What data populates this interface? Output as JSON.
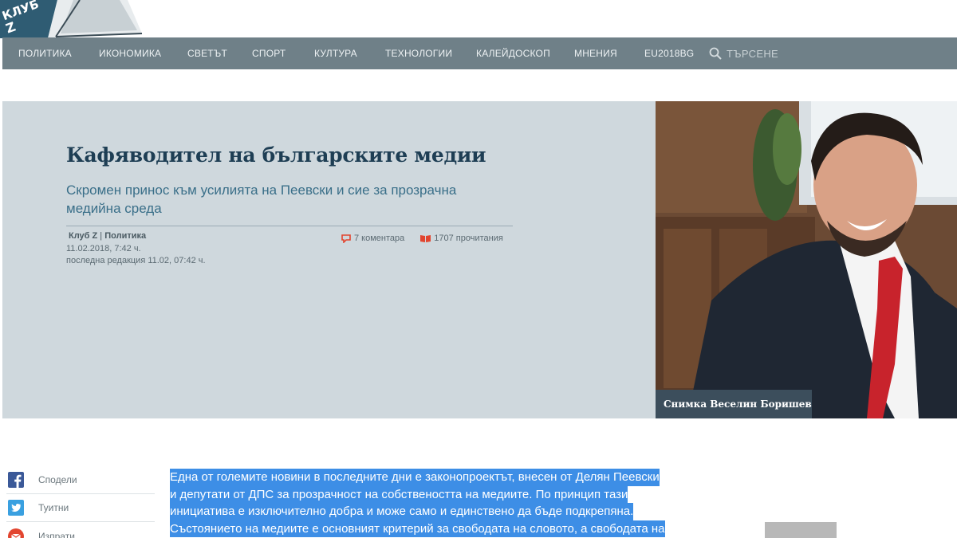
{
  "logo": {
    "text": "КЛУБ Z"
  },
  "nav": {
    "items": [
      "ПОЛИТИКА",
      "ИКОНОМИКА",
      "СВЕТЪТ",
      "СПОРТ",
      "КУЛТУРА",
      "ТЕХНОЛОГИИ",
      "КАЛЕЙДОСКОП",
      "МНЕНИЯ",
      "EU2018BG"
    ],
    "search_label": "ТЪРСЕНЕ"
  },
  "article": {
    "title": "Кафяводител на българските медии",
    "subtitle": "Скромен принос към усилията на Пеевски и сие за прозрачна медийна среда",
    "source": "Клуб Z",
    "category": "Политика",
    "separator": " | ",
    "date": "11.02.2018, 7:42 ч.",
    "edited": "последна редакция 11.02, 07:42 ч.",
    "comments": "7 коментара",
    "views": "1707 прочитания",
    "photo_caption": "Снимка Веселин Боришев",
    "body_lines": [
      "Една от големите новини в последните дни е законопроектът, внесен от Делян Пеевски",
      "и депутати от ДПС за прозрачност на собствеността на медиите. По принцип тази",
      "инициатива е изключително добра и може само и единствено да бъде подкрепяна.",
      "Състоянието на медиите е основният критерий за свободата на словото, а свободата на"
    ]
  },
  "share": {
    "items": [
      {
        "label": "Сподели",
        "icon": "facebook-icon"
      },
      {
        "label": "Туитни",
        "icon": "twitter-icon"
      },
      {
        "label": "Изпрати",
        "icon": "email-icon"
      }
    ]
  },
  "colors": {
    "nav_bg": "#6f8088",
    "hero_bg": "#cfd8dd",
    "title": "#1e3e54",
    "subtitle": "#3a6f89",
    "selection": "#3d8ee6",
    "accent": "#e2452f"
  }
}
